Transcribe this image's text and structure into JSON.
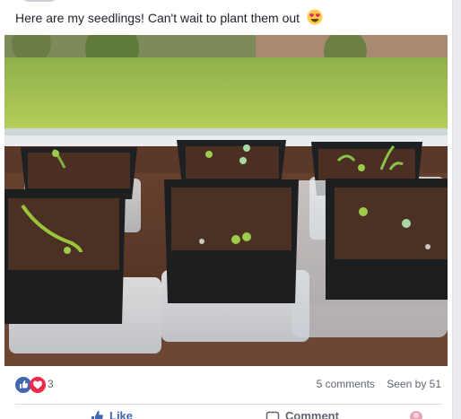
{
  "post": {
    "text": "Here are my seedlings! Can't wait to plant them out",
    "emoji": "heart-eyes-emoji"
  },
  "reactions": {
    "icons": [
      "like-icon",
      "love-icon"
    ],
    "count": "3"
  },
  "stats": {
    "comments": "5 comments",
    "seen_by": "Seen by 51"
  },
  "actions": {
    "like": "Like",
    "comment": "Comment",
    "share": ""
  },
  "colors": {
    "like_blue": "#4267b2",
    "love_red": "#f0284a",
    "meta_text": "#606770"
  }
}
